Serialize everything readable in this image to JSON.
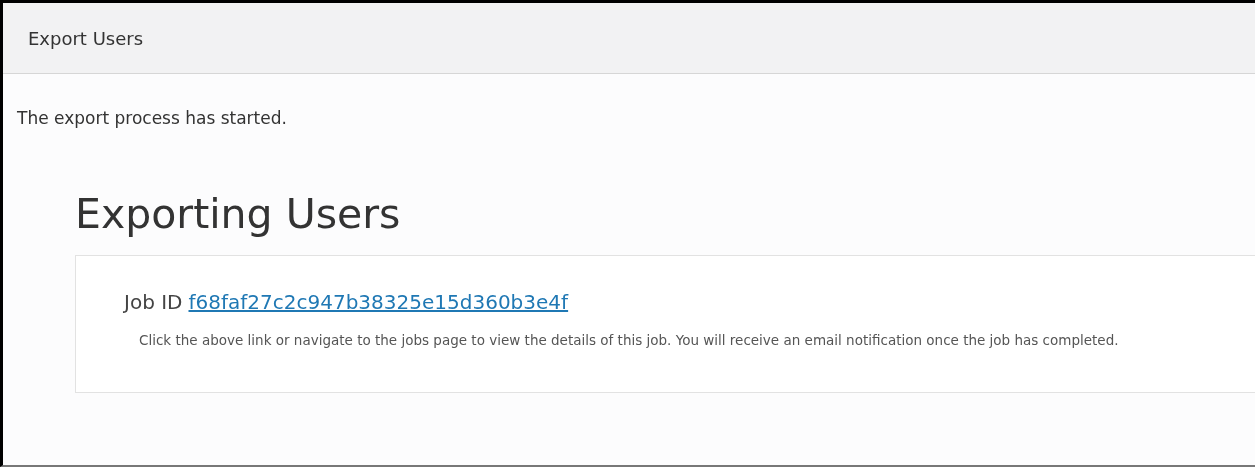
{
  "dialog": {
    "title": "Export Users"
  },
  "message": "The export process has started.",
  "heading": "Exporting Users",
  "job": {
    "label": "Job ID",
    "id": "f68faf27c2c947b38325e15d360b3e4f",
    "description": "Click the above link or navigate to the jobs page to view the details of this job. You will receive an email notification once the job has completed."
  }
}
